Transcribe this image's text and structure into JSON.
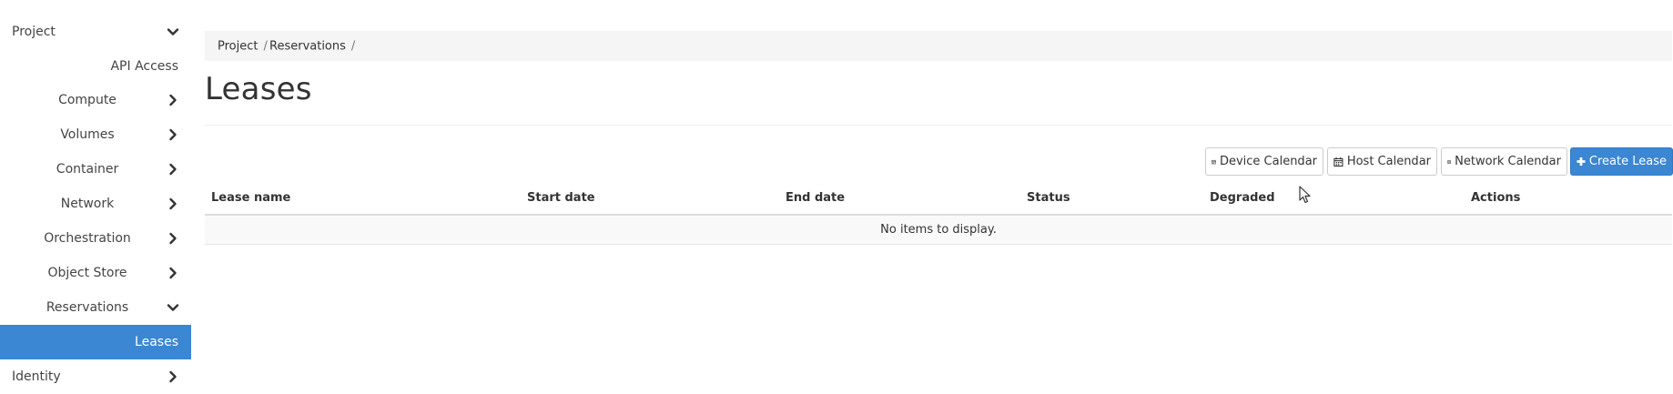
{
  "sidebar": {
    "project_label": "Project",
    "api_access_label": "API Access",
    "compute_label": "Compute",
    "volumes_label": "Volumes",
    "container_label": "Container",
    "network_label": "Network",
    "orchestration_label": "Orchestration",
    "object_store_label": "Object Store",
    "reservations_label": "Reservations",
    "leases_label": "Leases",
    "identity_label": "Identity",
    "active_color": "#3b87d3"
  },
  "breadcrumb": {
    "project": "Project",
    "reservations": "Reservations",
    "separator": "/"
  },
  "page": {
    "title": "Leases"
  },
  "toolbar": {
    "device_calendar": "Device Calendar",
    "host_calendar": "Host Calendar",
    "network_calendar": "Network Calendar",
    "create_lease": "Create Lease",
    "primary_color": "#3b87d3"
  },
  "table": {
    "columns": [
      "Lease name",
      "Start date",
      "End date",
      "Status",
      "Degraded",
      "Actions"
    ],
    "empty_message": "No items to display."
  },
  "icons": {
    "calendar": "calendar-icon",
    "plus": "plus-icon",
    "chevron_right": "chevron-right-icon",
    "chevron_down": "chevron-down-icon"
  }
}
